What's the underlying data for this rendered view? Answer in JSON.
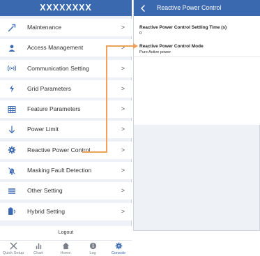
{
  "left_panel": {
    "title": "XXXXXXXX",
    "menu": [
      {
        "label": "Maintenance",
        "icon": "wrench-icon"
      },
      {
        "label": "Access Management",
        "icon": "user-icon"
      },
      {
        "label": "Communication Setting",
        "icon": "wifi-signal-icon"
      },
      {
        "label": "Grid Parameters",
        "icon": "lightning-icon"
      },
      {
        "label": "Feature Parameters",
        "icon": "grid-icon"
      },
      {
        "label": "Power Limit",
        "icon": "down-arrow-icon"
      },
      {
        "label": "Reactive Power Control",
        "icon": "gear-icon"
      },
      {
        "label": "Masking Fault Detection",
        "icon": "bell-off-icon"
      },
      {
        "label": "Other Setting",
        "icon": "menu-icon"
      },
      {
        "label": "Hybrid Setting",
        "icon": "battery-icon"
      }
    ],
    "chevron": ">",
    "logout_label": "Logout",
    "tabs": [
      {
        "label": "Quick Setup",
        "icon": "tools-icon"
      },
      {
        "label": "Chart",
        "icon": "bar-chart-icon"
      },
      {
        "label": "Home",
        "icon": "home-icon"
      },
      {
        "label": "Log",
        "icon": "info-icon"
      },
      {
        "label": "Console",
        "icon": "gear-icon",
        "active": true
      }
    ]
  },
  "right_panel": {
    "title": "Reactive Power Control",
    "fields": [
      {
        "label": "Reactive Power Control Settling Time (s)",
        "value": "0"
      },
      {
        "label": "Reactive Power Control Mode",
        "value": "Pure Active power"
      }
    ]
  },
  "colors": {
    "header_blue": "#3b69b0",
    "connector_orange": "#f2a15a",
    "background": "#eef1f6"
  }
}
